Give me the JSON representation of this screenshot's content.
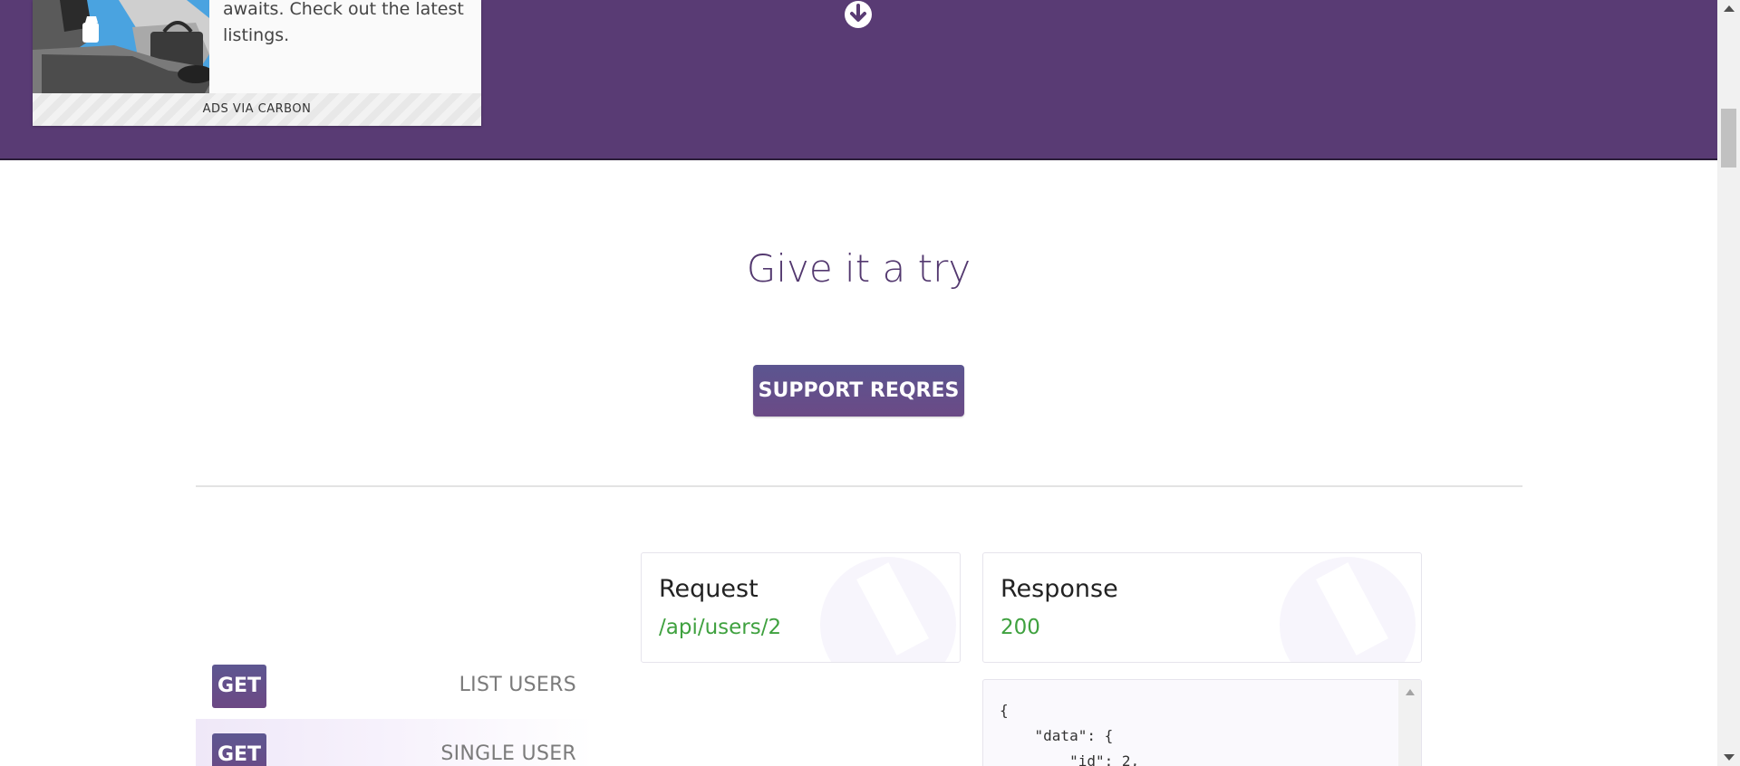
{
  "ad": {
    "text": "awaits. Check out the latest listings.",
    "footer": "ADS VIA CARBON"
  },
  "hero": {
    "scroll_icon": "arrow-down-circle-icon",
    "background": "#593b74"
  },
  "section": {
    "title": "Give it a try",
    "support_button": "SUPPORT REQRES"
  },
  "endpoints": [
    {
      "method": "GET",
      "label": "LIST USERS",
      "active": false
    },
    {
      "method": "GET",
      "label": "SINGLE USER",
      "active": true
    }
  ],
  "request": {
    "title": "Request",
    "url": "/api/users/2"
  },
  "response": {
    "title": "Response",
    "status": "200",
    "body_preview": "{\n    \"data\": {\n        \"id\": 2,"
  },
  "colors": {
    "accent": "#593b74",
    "success": "#3fa13f"
  }
}
